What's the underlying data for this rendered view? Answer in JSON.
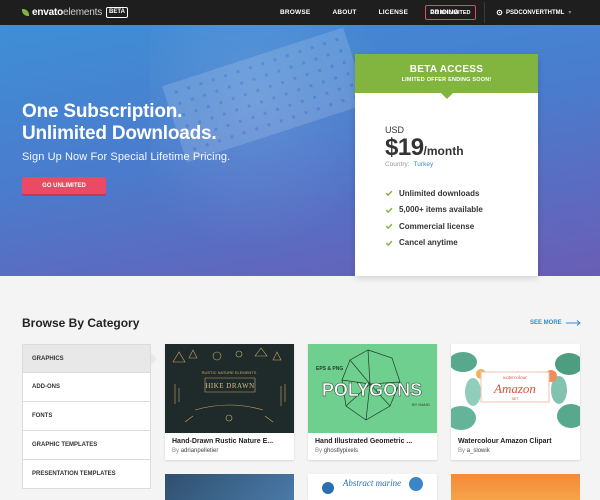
{
  "nav": {
    "logo_bold": "envato",
    "logo_thin": "elements",
    "beta": "BETA",
    "links": [
      "BROWSE",
      "ABOUT",
      "LICENSE",
      "PRICING"
    ],
    "cta": "GO UNLIMITED",
    "user": "PSDCONVERTHTML"
  },
  "hero": {
    "title_line1": "One Subscription.",
    "title_line2": "Unlimited Downloads.",
    "subtitle": "Sign Up Now For Special Lifetime Pricing.",
    "button": "GO UNLIMITED"
  },
  "card": {
    "title": "BETA ACCESS",
    "subtitle": "LIMITED OFFER ENDING SOON!",
    "currency": "USD",
    "price": "$19",
    "period": "/month",
    "country_label": "Country:",
    "country_value": "Turkey",
    "features": [
      "Unlimited downloads",
      "5,000+ items available",
      "Commercial license",
      "Cancel anytime"
    ],
    "check_color": "#82b440"
  },
  "browse": {
    "title": "Browse By Category",
    "see_more": "SEE MORE",
    "categories": [
      "GRAPHICS",
      "ADD-ONS",
      "FONTS",
      "GRAPHIC TEMPLATES",
      "PRESENTATION TEMPLATES"
    ],
    "items": [
      {
        "title": "Hand-Drawn Rustic Nature E...",
        "by": "By",
        "author": "adrianpelletier",
        "thumb_text": "RUSTIC NATURE ELEMENTS"
      },
      {
        "title": "Hand Illustrated Geometric ...",
        "by": "By",
        "author": "ghostlypixels",
        "thumb_text": "POLYGONS",
        "thumb_top": "EPS & PNG",
        "thumb_sub": "BY HAND"
      },
      {
        "title": "Watercolour Amazon Clipart",
        "by": "By",
        "author": "a_slowik",
        "thumb_text": "Amazon",
        "thumb_top": "watercolour",
        "thumb_sub": "SET"
      }
    ],
    "bottom_thumb_text": "Abstract marine"
  },
  "colors": {
    "accent_green": "#82b440",
    "accent_pink": "#ea4a63",
    "link_blue": "#2e8dd1",
    "nav_bg": "#1e1e1e"
  }
}
